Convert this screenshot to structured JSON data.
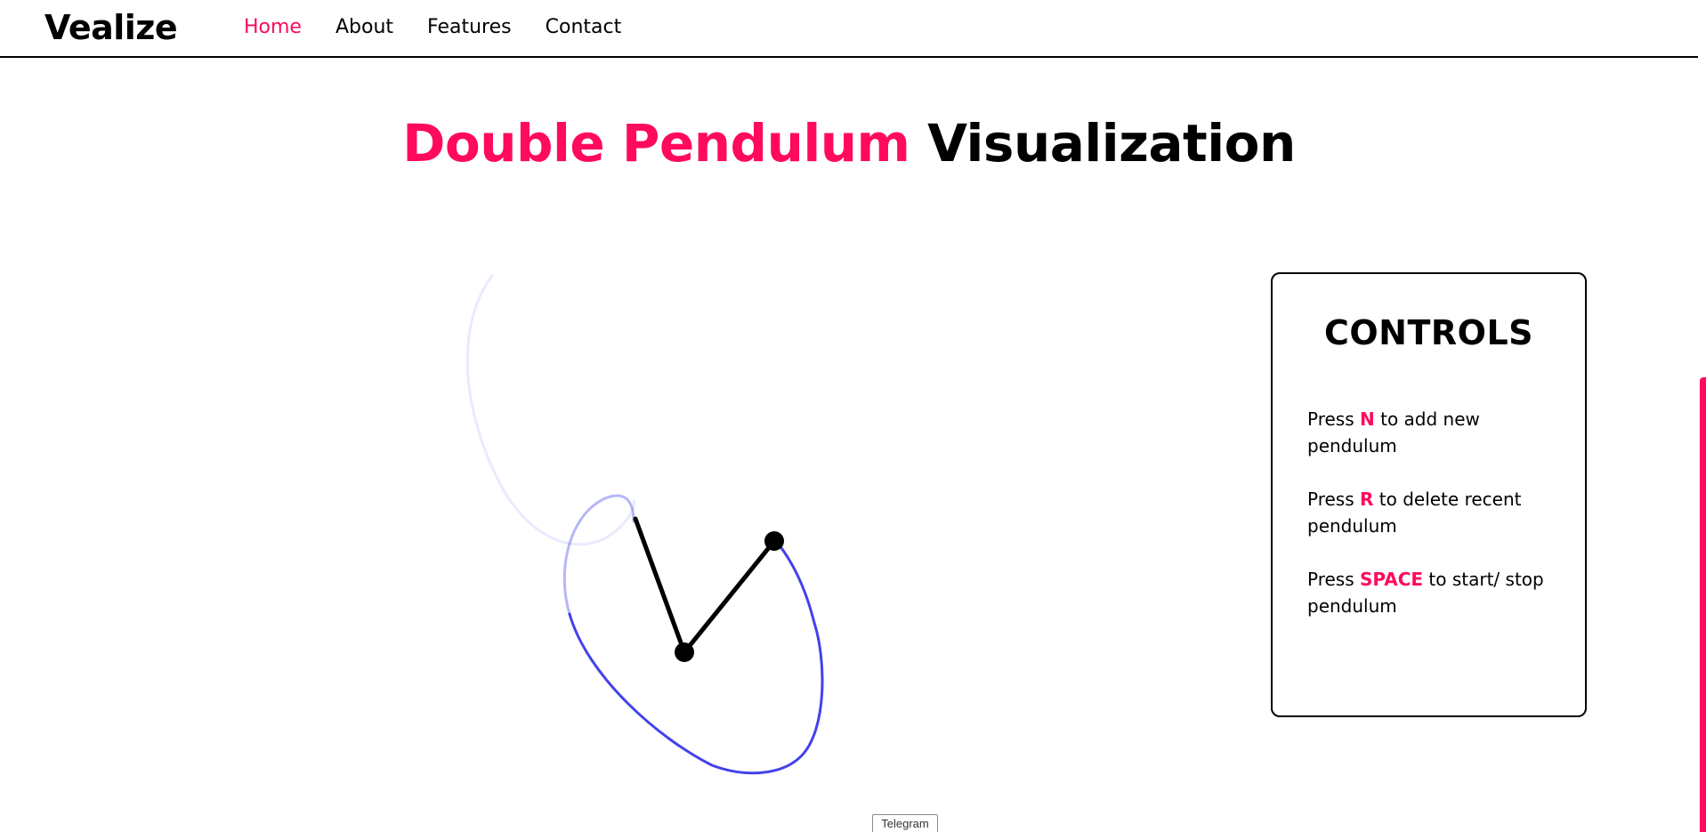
{
  "brand": "Vealize",
  "nav": {
    "items": [
      {
        "label": "Home",
        "active": true
      },
      {
        "label": "About",
        "active": false
      },
      {
        "label": "Features",
        "active": false
      },
      {
        "label": "Contact",
        "active": false
      }
    ]
  },
  "hero": {
    "title_accent": "Double Pendulum",
    "title_plain": "Visualization"
  },
  "controls": {
    "title": "CONTROLS",
    "items": [
      {
        "prefix": "Press ",
        "key": "N",
        "suffix": " to add new pendulum"
      },
      {
        "prefix": "Press ",
        "key": "R",
        "suffix": " to delete recent pendulum"
      },
      {
        "prefix": "Press ",
        "key": "SPACE",
        "suffix": " to start/ stop pendulum"
      }
    ]
  },
  "telegram_badge": "Telegram",
  "colors": {
    "accent": "#ff0a5c",
    "trail": "#2e2eea",
    "rod": "#000000"
  },
  "icons": {
    "telegram": "telegram-badge"
  }
}
